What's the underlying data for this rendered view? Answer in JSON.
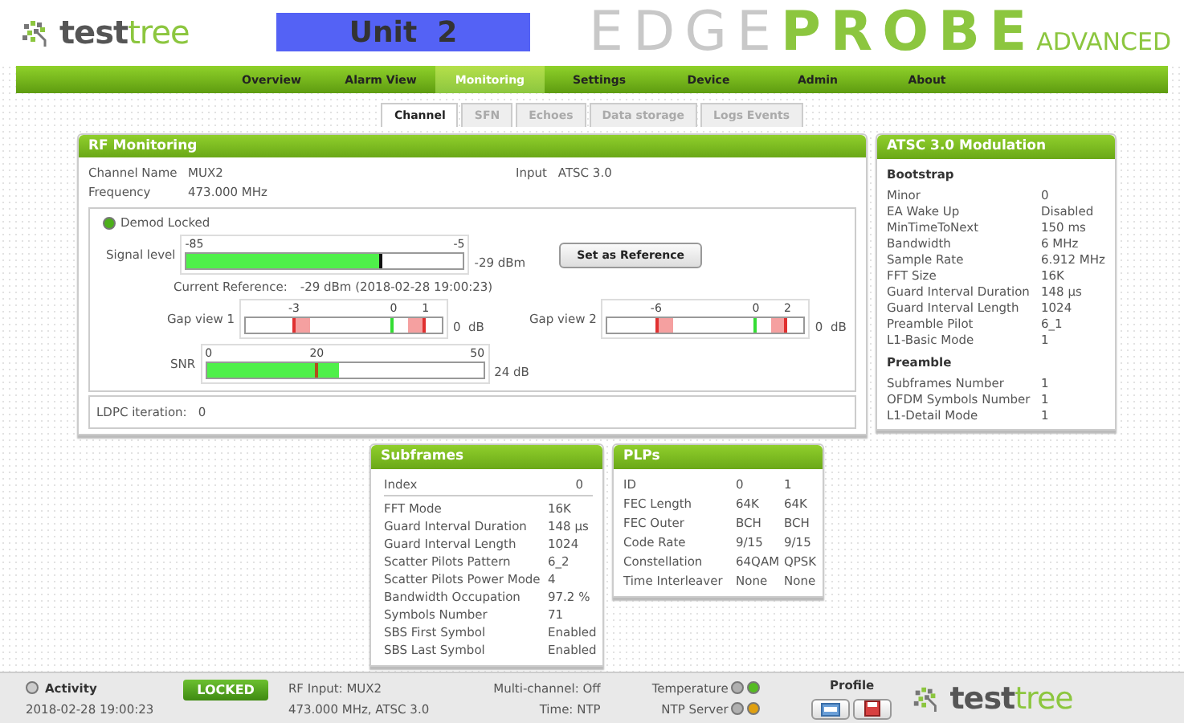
{
  "header": {
    "logo": [
      {
        "text": "test",
        "kind": "dark"
      },
      {
        "text": "tree",
        "kind": "accent"
      }
    ],
    "unit": "Unit  2",
    "product": [
      {
        "text": "EDGE",
        "kind": "light"
      },
      {
        "text": "PROBE",
        "kind": "accent"
      },
      {
        "text": "ADVANCED",
        "kind": "small"
      }
    ]
  },
  "nav": [
    {
      "label": "Overview",
      "selected": false
    },
    {
      "label": "Alarm View",
      "selected": false
    },
    {
      "label": "Monitoring",
      "selected": true
    },
    {
      "label": "Settings",
      "selected": false
    },
    {
      "label": "Device",
      "selected": false
    },
    {
      "label": "Admin",
      "selected": false
    },
    {
      "label": "About",
      "selected": false
    }
  ],
  "tabs": [
    {
      "label": "Channel",
      "selected": true
    },
    {
      "label": "SFN",
      "selected": false
    },
    {
      "label": "Echoes",
      "selected": false
    },
    {
      "label": "Data storage",
      "selected": false
    },
    {
      "label": "Logs Events",
      "selected": false
    }
  ],
  "rf_monitoring": {
    "title": "RF Monitoring",
    "fields": [
      {
        "label": "Channel Name",
        "value": "MUX2"
      },
      {
        "label": "Frequency",
        "value": "473.000 MHz"
      }
    ],
    "input": {
      "label": "Input",
      "value": "ATSC 3.0"
    },
    "demod": {
      "label": "Demod Locked",
      "locked": true
    },
    "signal": {
      "label": "Signal level",
      "level": 0.7,
      "marker": {
        "level": 0.7
      },
      "ticks": [
        {
          "label": "-85",
          "kind": "start"
        },
        {
          "label": "-5",
          "kind": "end"
        }
      ],
      "reading": "-29 dBm"
    },
    "set_reference": "Set as Reference",
    "reference": {
      "label": "Current Reference:",
      "value": "-29  dBm  (2018-02-28 19:00:23)"
    },
    "gap_views": [
      {
        "label": "Gap view 1",
        "markers": [
          {
            "kind": "low",
            "label": "-3",
            "level": 0.25
          },
          {
            "kind": "zero",
            "label": "0",
            "level": 0.75
          },
          {
            "kind": "high",
            "label": "1",
            "level": 0.91
          }
        ],
        "reading": "0  dB"
      },
      {
        "label": "Gap view 2",
        "markers": [
          {
            "kind": "low",
            "label": "-6",
            "level": 0.25
          },
          {
            "kind": "zero",
            "label": "0",
            "level": 0.75
          },
          {
            "kind": "high",
            "label": "2",
            "level": 0.91
          }
        ],
        "reading": "0  dB"
      }
    ],
    "snr": {
      "label": "SNR",
      "level": 0.48,
      "marker": {
        "level": 0.4
      },
      "ticks": [
        {
          "label": "0",
          "kind": "start"
        },
        {
          "label": "20",
          "kind": "marker"
        },
        {
          "label": "50",
          "kind": "end"
        }
      ],
      "reading": "24 dB"
    },
    "ldpc": {
      "label": "LDPC iteration:",
      "value": "0"
    }
  },
  "modulation": {
    "title": "ATSC 3.0 Modulation",
    "sections": [
      {
        "title": "Bootstrap",
        "rows": [
          {
            "label": "Minor",
            "value": "0"
          },
          {
            "label": "EA Wake Up",
            "value": "Disabled"
          },
          {
            "label": "MinTimeToNext",
            "value": "150 ms"
          },
          {
            "label": "Bandwidth",
            "value": "6 MHz"
          },
          {
            "label": "Sample Rate",
            "value": "6.912 MHz"
          },
          {
            "label": "FFT Size",
            "value": "16K"
          },
          {
            "label": "Guard Interval Duration",
            "value": "148 µs"
          },
          {
            "label": "Guard Interval Length",
            "value": "1024"
          },
          {
            "label": "Preamble Pilot",
            "value": "6_1"
          },
          {
            "label": "L1-Basic Mode",
            "value": "1"
          }
        ]
      },
      {
        "title": "Preamble",
        "rows": [
          {
            "label": "Subframes Number",
            "value": "1"
          },
          {
            "label": "OFDM Symbols Number",
            "value": "1"
          },
          {
            "label": "L1-Detail Mode",
            "value": "1"
          }
        ]
      }
    ]
  },
  "subframes": {
    "title": "Subframes",
    "index": {
      "label": "Index",
      "value": "0"
    },
    "rows": [
      {
        "label": "FFT Mode",
        "value": "16K"
      },
      {
        "label": "Guard Interval Duration",
        "value": "148 µs"
      },
      {
        "label": "Guard Interval Length",
        "value": "1024"
      },
      {
        "label": "Scatter Pilots Pattern",
        "value": "6_2"
      },
      {
        "label": "Scatter Pilots Power Mode",
        "value": "4"
      },
      {
        "label": "Bandwidth Occupation",
        "value": "97.2 %"
      },
      {
        "label": "Symbols Number",
        "value": "71"
      },
      {
        "label": "SBS First Symbol",
        "value": "Enabled"
      },
      {
        "label": "SBS Last Symbol",
        "value": "Enabled"
      }
    ]
  },
  "plps": {
    "title": "PLPs",
    "rows": [
      {
        "label": "ID",
        "values": [
          "0",
          "1"
        ]
      },
      {
        "label": "FEC Length",
        "values": [
          "64K",
          "64K"
        ]
      },
      {
        "label": "FEC Outer",
        "values": [
          "BCH",
          "BCH"
        ]
      },
      {
        "label": "Code Rate",
        "values": [
          "9/15",
          "9/15"
        ]
      },
      {
        "label": "Constellation",
        "values": [
          "64QAM",
          "QPSK"
        ]
      },
      {
        "label": "Time Interleaver",
        "values": [
          "None",
          "None"
        ]
      }
    ]
  },
  "status_bar": {
    "activity": {
      "label": "Activity",
      "active": false
    },
    "time": "2018-02-28 19:00:23",
    "locked": "LOCKED",
    "rf_input": [
      "RF Input: MUX2",
      "473.000 MHz, ATSC 3.0"
    ],
    "multi_channel": "Multi-channel: Off",
    "time_source": "Time: NTP",
    "indicators": [
      {
        "label": "Temperature",
        "lights": [
          {
            "color": "#b0b0b0"
          },
          {
            "color": "#55bb22"
          }
        ]
      },
      {
        "label": "NTP Server",
        "lights": [
          {
            "color": "#b0b0b0"
          },
          {
            "color": "#e0a010"
          }
        ]
      }
    ],
    "profile": "Profile",
    "logo": [
      {
        "text": "test",
        "kind": "dark"
      },
      {
        "text": "tree",
        "kind": "accent"
      }
    ]
  }
}
